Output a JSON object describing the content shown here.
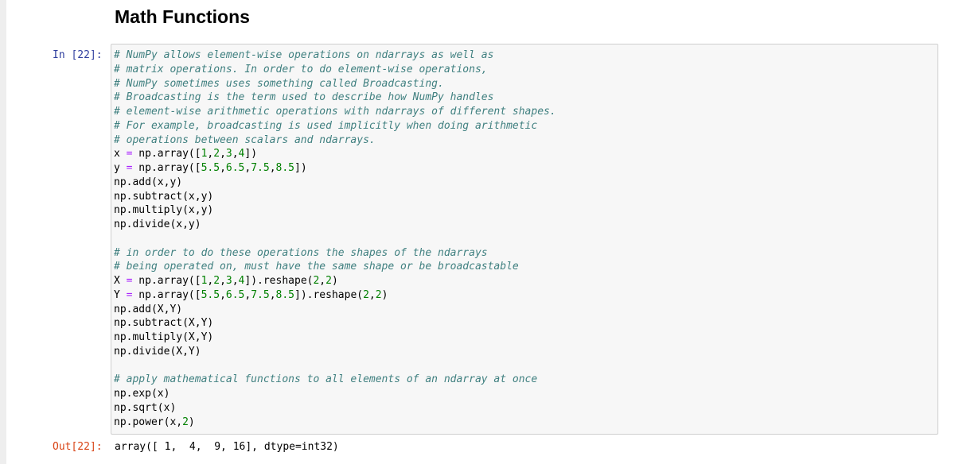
{
  "section_heading": "Math Functions",
  "cell": {
    "input_prompt": "In [22]:",
    "output_prompt": "Out[22]:",
    "output_text": "array([ 1,  4,  9, 16], dtype=int32)",
    "code_lines": [
      "# NumPy allows element-wise operations on ndarrays as well as",
      "# matrix operations. In order to do element-wise operations,",
      "# NumPy sometimes uses something called Broadcasting.",
      "# Broadcasting is the term used to describe how NumPy handles",
      "# element-wise arithmetic operations with ndarrays of different shapes.",
      "# For example, broadcasting is used implicitly when doing arithmetic",
      "# operations between scalars and ndarrays.",
      "x = np.array([1,2,3,4])",
      "y = np.array([5.5,6.5,7.5,8.5])",
      "np.add(x,y)",
      "np.subtract(x,y)",
      "np.multiply(x,y)",
      "np.divide(x,y)",
      "",
      "# in order to do these operations the shapes of the ndarrays",
      "# being operated on, must have the same shape or be broadcastable",
      "X = np.array([1,2,3,4]).reshape(2,2)",
      "Y = np.array([5.5,6.5,7.5,8.5]).reshape(2,2)",
      "np.add(X,Y)",
      "np.subtract(X,Y)",
      "np.multiply(X,Y)",
      "np.divide(X,Y)",
      "",
      "# apply mathematical functions to all elements of an ndarray at once",
      "np.exp(x)",
      "np.sqrt(x)",
      "np.power(x,2)"
    ]
  }
}
